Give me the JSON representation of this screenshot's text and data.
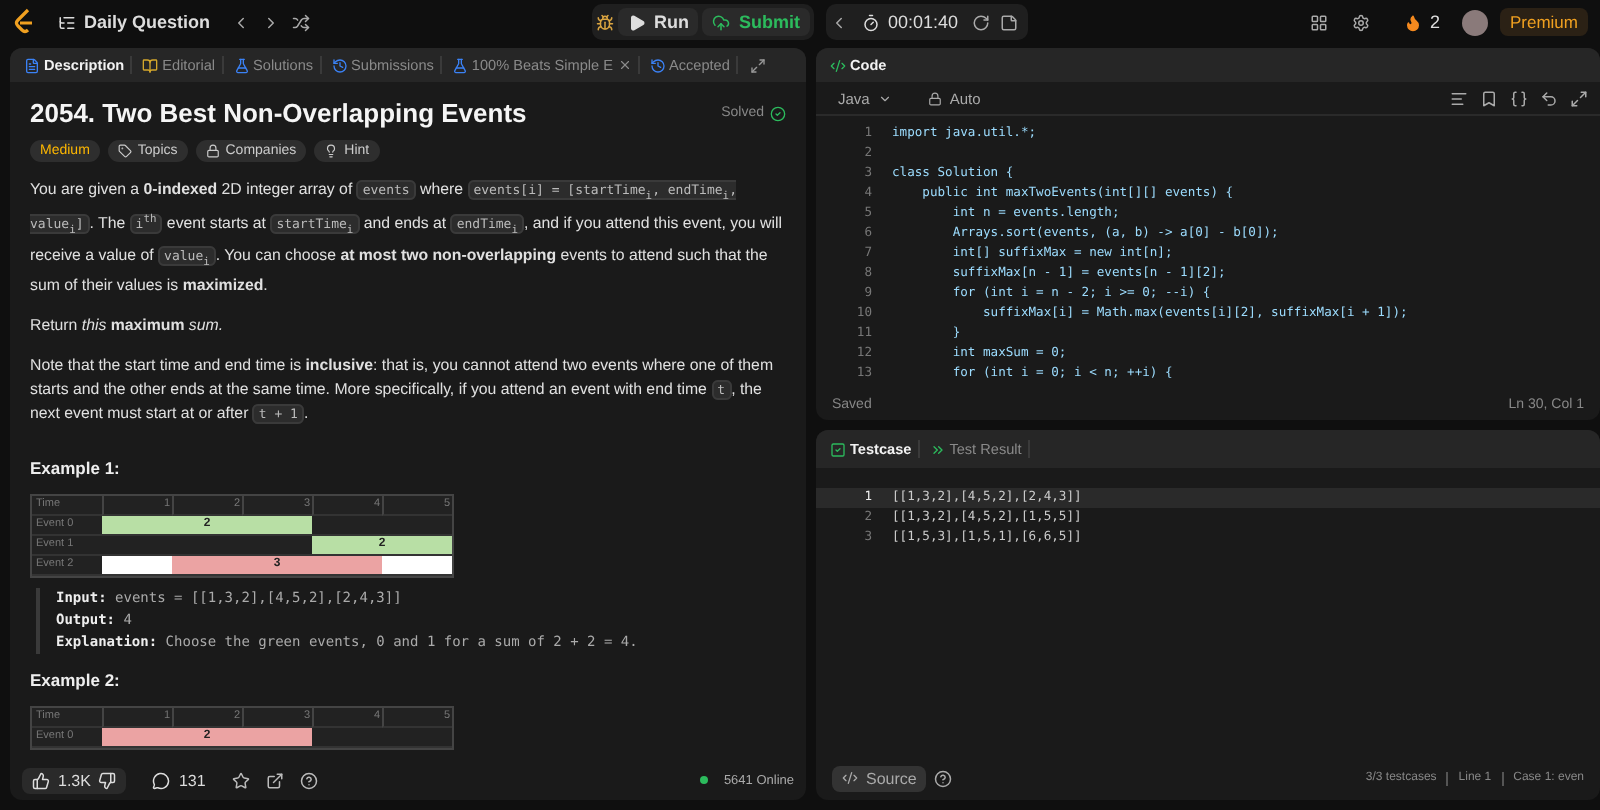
{
  "top_bar": {
    "problem_list": "Daily Question",
    "run": "Run",
    "submit": "Submit",
    "timer": "00:01:40",
    "streak": "2",
    "premium": "Premium"
  },
  "left_panel": {
    "tabs": [
      {
        "label": "Description",
        "selected": true,
        "closable": false
      },
      {
        "label": "Editorial",
        "selected": false,
        "closable": false
      },
      {
        "label": "Solutions",
        "selected": false,
        "closable": false
      },
      {
        "label": "Submissions",
        "selected": false,
        "closable": false
      },
      {
        "label": "100% Beats Simple E",
        "selected": false,
        "closable": true
      },
      {
        "label": "Accepted",
        "selected": false,
        "closable": false
      }
    ],
    "title": "2054. Two Best Non-Overlapping Events",
    "status": "Solved",
    "tags": [
      {
        "kind": "difficulty",
        "label": "Medium"
      },
      {
        "kind": "topics",
        "label": "Topics"
      },
      {
        "kind": "companies",
        "label": "Companies"
      },
      {
        "kind": "hint",
        "label": "Hint"
      }
    ],
    "paragraphs": [
      [
        {
          "kind": "text",
          "text": "You are given a **0-indexed** 2D integer array of "
        },
        {
          "kind": "code",
          "text": "events"
        },
        {
          "kind": "text",
          "text": " where "
        },
        {
          "kind": "code",
          "text": "events[i] = [startTime$_{i}$, endTime$_{i}$, value$_{i}$]"
        },
        {
          "kind": "text",
          "text": ". The "
        },
        {
          "kind": "code",
          "text": "i$^{th}$"
        },
        {
          "kind": "text",
          "text": " event starts at "
        },
        {
          "kind": "code",
          "text": "startTime$_{i}$"
        },
        {
          "kind": "text",
          "text": " and ends at "
        },
        {
          "kind": "code",
          "text": "endTime$_{i}$"
        },
        {
          "kind": "text",
          "text": ", and if you attend this event, you will receive a value of "
        },
        {
          "kind": "code",
          "text": "value$_{i}$"
        },
        {
          "kind": "text",
          "text": ". You can choose **at most two non-overlapping** events to attend such that the sum of their values is **maximized**."
        }
      ],
      [
        {
          "kind": "text",
          "text": "Return *this* **maximum** *sum.*"
        }
      ],
      [
        {
          "kind": "text",
          "text": "Note that the start time and end time is **inclusive**: that is, you cannot attend two events where one of them starts and the other ends at the same time. More specifically, if you attend an event with end time "
        },
        {
          "kind": "code",
          "text": "t"
        },
        {
          "kind": "text",
          "text": ", the next event must start at or after "
        },
        {
          "kind": "code",
          "text": "t + 1"
        },
        {
          "kind": "text",
          "text": "."
        }
      ]
    ],
    "examples": [
      {
        "title": "Example 1:",
        "timeline": {
          "header": "Time",
          "ticks": [
            "1",
            "2",
            "3",
            "4",
            "5"
          ],
          "rows": [
            {
              "label": "Event 0",
              "value": "2",
              "color": "#b8dfa5",
              "cells": [
                {
                  "kind": "bar"
                },
                {
                  "kind": "bar"
                },
                {
                  "kind": "bar"
                },
                {
                  "kind": "empty"
                },
                {
                  "kind": "empty"
                }
              ]
            },
            {
              "label": "Event 1",
              "value": "2",
              "color": "#b8dfa5",
              "cells": [
                {
                  "kind": "empty"
                },
                {
                  "kind": "empty"
                },
                {
                  "kind": "empty"
                },
                {
                  "kind": "bar"
                },
                {
                  "kind": "bar"
                }
              ]
            },
            {
              "label": "Event 2",
              "value": "3",
              "color": "#eba3a3",
              "cells": [
                {
                  "kind": "blank"
                },
                {
                  "kind": "bar"
                },
                {
                  "kind": "bar"
                },
                {
                  "kind": "bar"
                },
                {
                  "kind": "blank"
                }
              ]
            }
          ]
        },
        "io": [
          {
            "label": "Input:",
            "text": "events = [[1,3,2],[4,5,2],[2,4,3]]"
          },
          {
            "label": "Output:",
            "text": "4"
          },
          {
            "label": "Explanation:",
            "text": "Choose the green events, 0 and 1 for a sum of 2 + 2 = 4."
          }
        ]
      },
      {
        "title": "Example 2:",
        "timeline": {
          "header": "Time",
          "ticks": [
            "1",
            "2",
            "3",
            "4",
            "5"
          ],
          "rows": [
            {
              "label": "Event 0",
              "value": "2",
              "color": "#eba3a3",
              "cells": [
                {
                  "kind": "bar"
                },
                {
                  "kind": "bar"
                },
                {
                  "kind": "bar"
                },
                {
                  "kind": "empty"
                },
                {
                  "kind": "empty"
                }
              ]
            }
          ]
        }
      }
    ],
    "footer": {
      "likes": "1.3K",
      "comments": "131",
      "online": "5641 Online"
    }
  },
  "code_panel": {
    "title": "Code",
    "language": "Java",
    "mode": "Auto",
    "lines": [
      {
        "n": "1",
        "code": "import java.util.*;"
      },
      {
        "n": "2"
      },
      {
        "n": "3",
        "code": "class Solution {"
      },
      {
        "n": "4",
        "code": "    public int maxTwoEvents(int[][] events) {"
      },
      {
        "n": "5",
        "code": "        int n = events.length;"
      },
      {
        "n": "6",
        "code": "        Arrays.sort(events, (a, b) -> a[0] - b[0]);"
      },
      {
        "n": "7",
        "code": "        int[] suffixMax = new int[n];"
      },
      {
        "n": "8",
        "code": "        suffixMax[n - 1] = events[n - 1][2];"
      },
      {
        "n": "9",
        "code": "        for (int i = n - 2; i >= 0; --i) {"
      },
      {
        "n": "10",
        "code": "            suffixMax[i] = Math.max(events[i][2], suffixMax[i + 1]);"
      },
      {
        "n": "11",
        "code": "        }"
      },
      {
        "n": "12",
        "code": "        int maxSum = 0;"
      },
      {
        "n": "13",
        "code": "        for (int i = 0; i < n; ++i) {"
      }
    ],
    "saved": "Saved",
    "cursor": "Ln 30, Col 1"
  },
  "test_panel": {
    "tabs": [
      {
        "label": "Testcase",
        "selected": true
      },
      {
        "label": "Test Result",
        "selected": false
      }
    ],
    "lines": [
      {
        "n": "1",
        "text": "[[1,3,2],[4,5,2],[2,4,3]]",
        "selected": true
      },
      {
        "n": "2",
        "text": "[[1,3,2],[4,5,2],[1,5,5]]",
        "selected": false
      },
      {
        "n": "3",
        "text": "[[1,5,3],[1,5,1],[6,6,5]]",
        "selected": false
      }
    ],
    "source": "Source",
    "status": [
      "3/3 testcases",
      "Line 1",
      "Case 1: even"
    ]
  }
}
